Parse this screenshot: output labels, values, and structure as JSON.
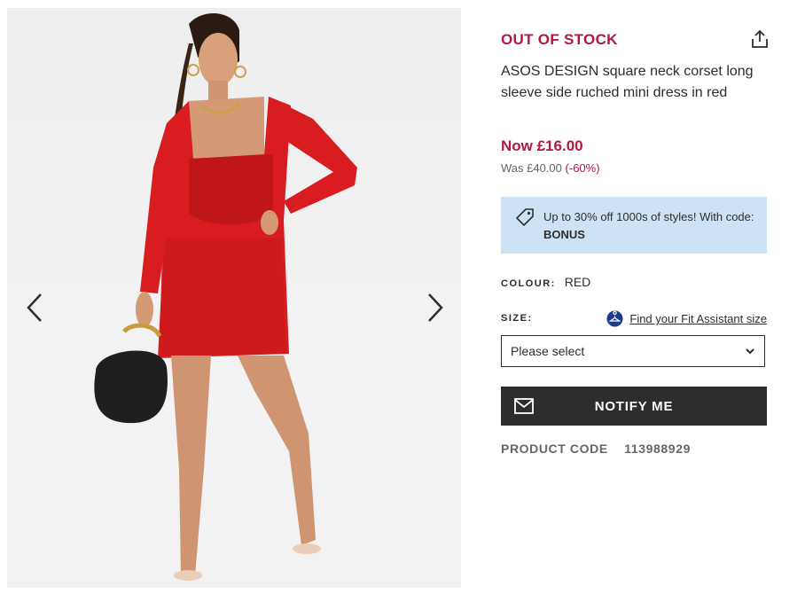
{
  "gallery": {
    "image_alt": "Model wearing red satin square neck corset mini dress with black bag",
    "prev_icon": "chevron-left-icon",
    "next_icon": "chevron-right-icon"
  },
  "product": {
    "stock_status": "OUT OF STOCK",
    "title": "ASOS DESIGN square neck corset long sleeve side ruched mini dress in red",
    "price_now": "Now £16.00",
    "price_was": "Was £40.00",
    "discount": "(-60%)",
    "share_icon": "share-icon"
  },
  "promo": {
    "text": "Up to 30% off 1000s of styles! With code: ",
    "code": "BONUS",
    "icon": "tag-icon"
  },
  "colour": {
    "label": "COLOUR:",
    "value": "RED"
  },
  "size": {
    "label": "SIZE:",
    "fit_link": "Find your Fit Assistant size",
    "select_value": "Please select"
  },
  "notify": {
    "label": "NOTIFY ME",
    "icon": "mail-icon"
  },
  "product_code": {
    "label": "PRODUCT CODE",
    "value": "113988929"
  },
  "colors": {
    "accent": "#b4173f",
    "promo_bg": "#cde2f5",
    "button_bg": "#2d2d2d"
  }
}
